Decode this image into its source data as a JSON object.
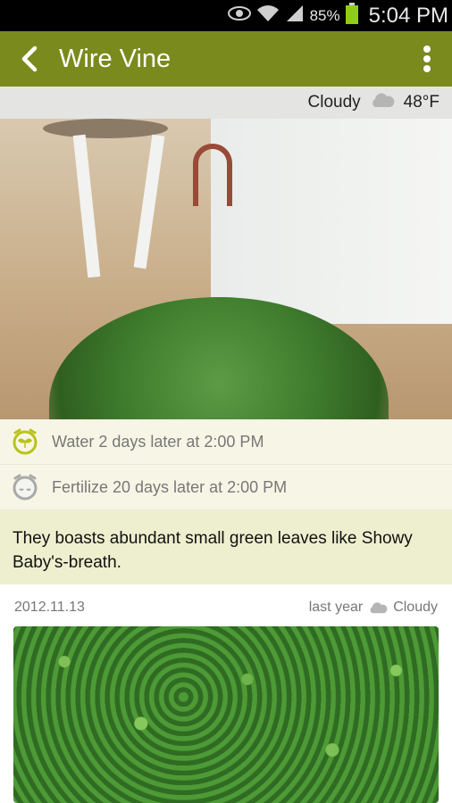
{
  "status_bar": {
    "battery_percent": "85%",
    "time": "5:04 PM",
    "icons": [
      "eye-icon",
      "wifi-icon",
      "signal-icon",
      "battery-icon"
    ]
  },
  "app_bar": {
    "title": "Wire Vine",
    "back_icon": "back-arrow-icon",
    "menu_icon": "overflow-menu-icon",
    "color": "#7b8a1c"
  },
  "weather": {
    "condition": "Cloudy",
    "temperature": "48°F",
    "icon": "cloud-icon"
  },
  "reminders": [
    {
      "icon": "alarm-clock-sprout-icon",
      "text": "Water 2 days later at 2:00 PM"
    },
    {
      "icon": "alarm-clock-sleep-icon",
      "text": "Fertilize 20 days later at 2:00 PM"
    }
  ],
  "description": "They boasts abundant small green leaves like Showy Baby's-breath.",
  "entry": {
    "date": "2012.11.13",
    "relative_time": "last year",
    "weather": "Cloudy"
  }
}
